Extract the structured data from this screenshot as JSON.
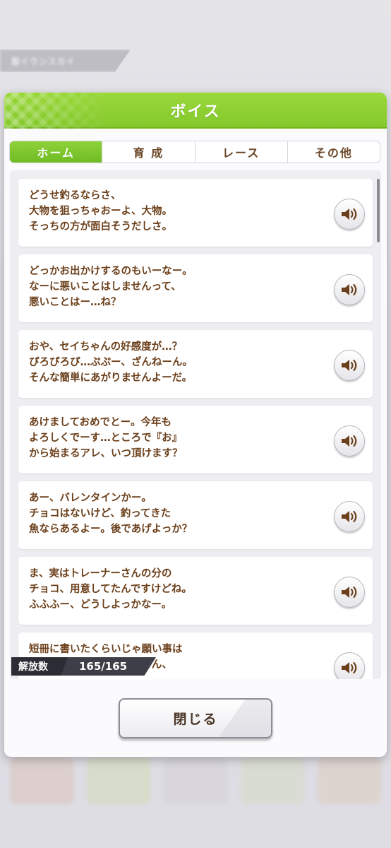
{
  "background": {
    "banner_text": "聖イウンスカイ"
  },
  "dialog": {
    "title": "ボイス",
    "tabs": [
      {
        "label": "ホーム",
        "active": true
      },
      {
        "label": "育 成",
        "active": false
      },
      {
        "label": "レース",
        "active": false
      },
      {
        "label": "その他",
        "active": false
      }
    ],
    "voices": [
      {
        "text": "どうせ釣るならさ、\n大物を狙っちゃおーよ、大物。\nそっちの方が面白そうだしさ。"
      },
      {
        "text": "どっかお出かけするのもいーなー。\nなーに悪いことはしませんって、\n悪いことはー…ね？"
      },
      {
        "text": "おや、セイちゃんの好感度が…？\nぴろぴろぴ…ぷぷー、ざんねーん。\nそんな簡単にあがりませんよーだ。"
      },
      {
        "text": "あけましておめでとー。今年も\nよろしくでーす…ところで『お』\nから始まるアレ、いつ頂けます？"
      },
      {
        "text": "あー、バレンタインかー。\nチョコはないけど、釣ってきた\n魚ならあるよー。後であげよっか？"
      },
      {
        "text": "ま、実はトレーナーさんの分の\nチョコ、用意してたんですけどね。\nふふふー、どうしよっかなー。"
      },
      {
        "text": "短冊に書いたくらいじゃ願い事は\n叶わないよ、トレーナーさん、"
      }
    ],
    "unlock": {
      "label": "解放数",
      "value": "165/165"
    },
    "close_label": "閉じる"
  },
  "colors": {
    "header_green": "#8ed034",
    "text_brown": "#6b3f1a",
    "tab_active": "#7dc72e"
  }
}
